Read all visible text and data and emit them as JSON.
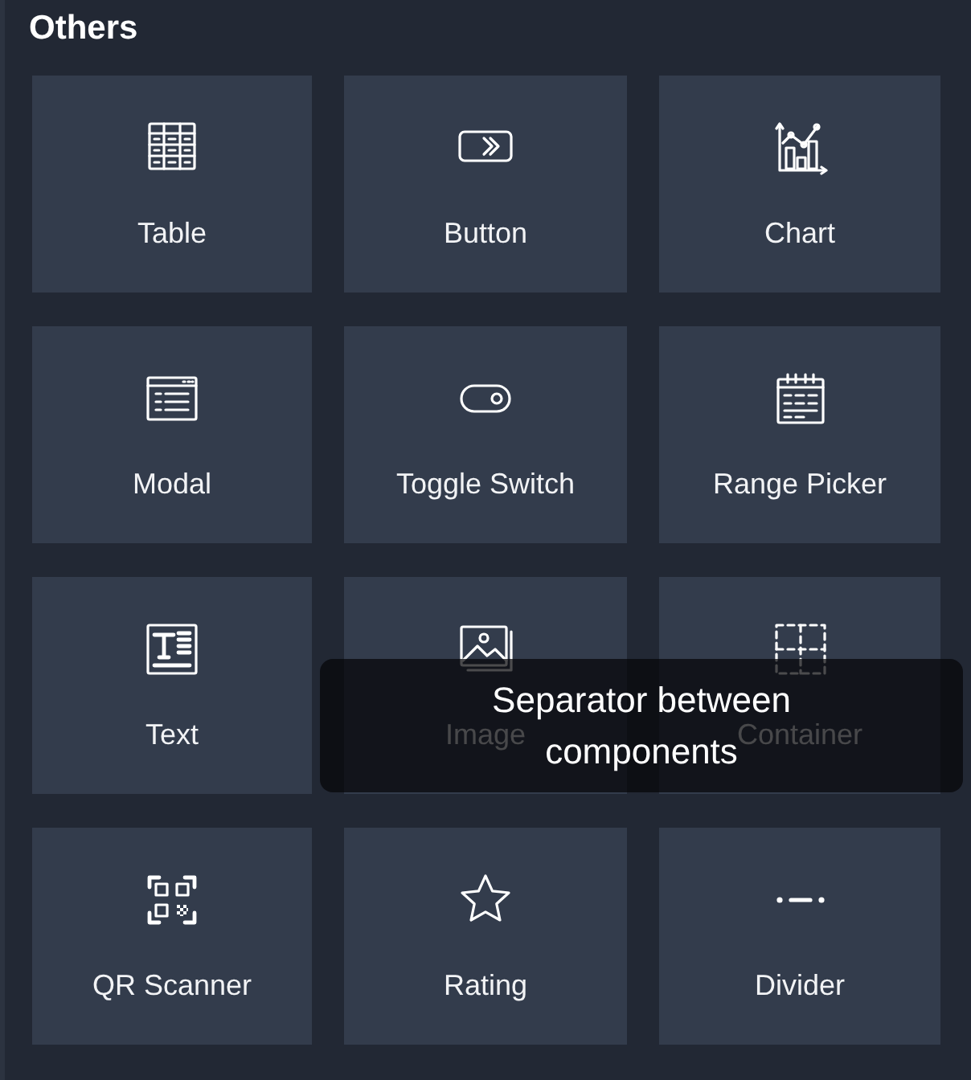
{
  "section": {
    "title": "Others"
  },
  "tiles": [
    {
      "label": "Table"
    },
    {
      "label": "Button"
    },
    {
      "label": "Chart"
    },
    {
      "label": "Modal"
    },
    {
      "label": "Toggle Switch"
    },
    {
      "label": "Range Picker"
    },
    {
      "label": "Text"
    },
    {
      "label": "Image"
    },
    {
      "label": "Container"
    },
    {
      "label": "QR Scanner"
    },
    {
      "label": "Rating"
    },
    {
      "label": "Divider"
    }
  ],
  "tooltip": {
    "text": "Separator between components"
  }
}
